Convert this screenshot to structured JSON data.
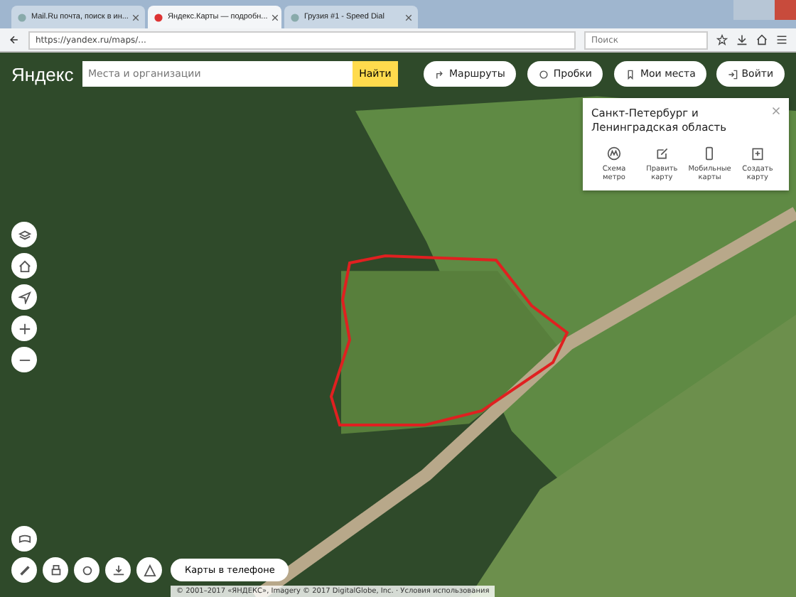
{
  "browser": {
    "tabs": [
      {
        "title": "Mail.Ru почта, поиск в ин...",
        "selected": false
      },
      {
        "title": "Яндекс.Карты — подробн...",
        "selected": true
      },
      {
        "title": "Грузия #1 - Speed Dial",
        "selected": false
      }
    ],
    "address": "https://yandex.ru/maps/...",
    "search_placeholder": "Поиск"
  },
  "map": {
    "logo": "Яндекс",
    "search": {
      "placeholder": "Места и организации"
    },
    "search_button": "Найти",
    "nav_buttons": [
      "Маршруты",
      "Пробки",
      "Мои места"
    ],
    "login_button": "Войти",
    "region_panel": {
      "title": "Санкт-Петербург и Ленинградская область",
      "actions": [
        "Схема метро",
        "Править карту",
        "Мобильные карты",
        "Создать карту"
      ]
    },
    "app_promo": "Карты в телефоне",
    "attribution": "© 2001–2017 «ЯНДЕКС», Imagery © 2017 DigitalGlobe, Inc. · Условия использования"
  }
}
